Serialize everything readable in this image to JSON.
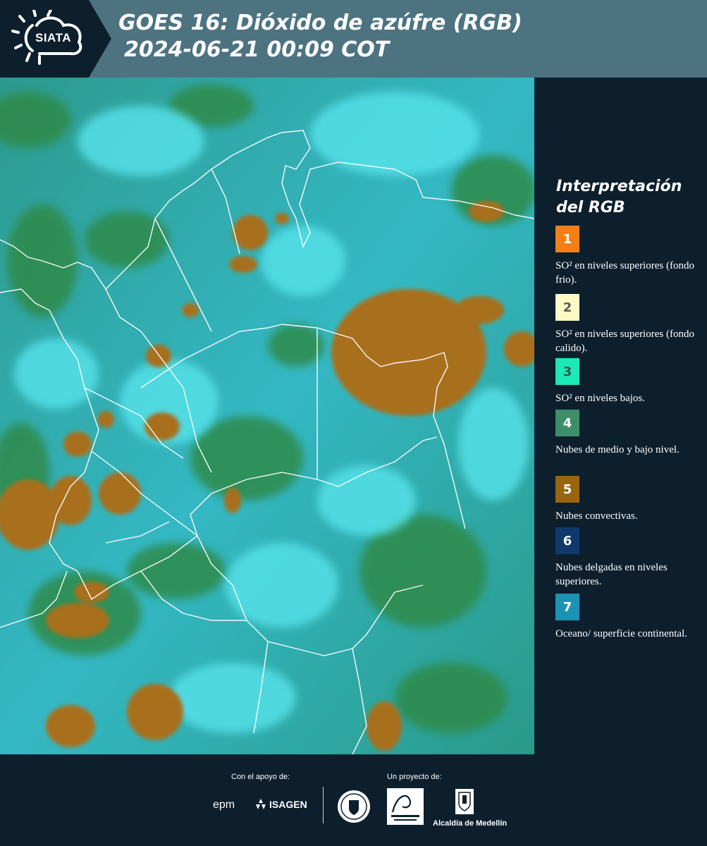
{
  "header": {
    "logo_text": "SIATA",
    "title_line1": "GOES 16: Dióxido de azúfre (RGB)",
    "title_line2": "2024-06-21 00:09 COT"
  },
  "legend": {
    "title": "Interpretación del RGB",
    "items": [
      {
        "number": "1",
        "color": "#f57f17",
        "text_color": "#ffffff",
        "description": "SO² en niveles superiores (fondo frio)."
      },
      {
        "number": "2",
        "color": "#fff9c4",
        "text_color": "#5a5a5a",
        "description": "SO² en niveles superiores (fondo calido)."
      },
      {
        "number": "3",
        "color": "#1de9b6",
        "text_color": "#2a5a55",
        "description": "SO² en niveles bajos."
      },
      {
        "number": "4",
        "color": "#3e8e6a",
        "text_color": "#ffffff",
        "description": "Nubes de medio y bajo nivel."
      },
      {
        "number": "5",
        "color": "#9a6410",
        "text_color": "#ffffff",
        "description": "Nubes convectivas."
      },
      {
        "number": "6",
        "color": "#0f3a6b",
        "text_color": "#ffffff",
        "description": "Nubes delgadas en niveles superiores."
      },
      {
        "number": "7",
        "color": "#1c93b4",
        "text_color": "#ffffff",
        "description": "Oceano/ superficie continental."
      }
    ]
  },
  "footer": {
    "support_label": "Con el apoyo de:",
    "project_label": "Un proyecto de:",
    "sponsor_epm": "epm",
    "sponsor_isagen": "ISAGEN",
    "partner_alcaldia": "Alcaldía de Medellín"
  },
  "colors": {
    "background": "#0d1f2d",
    "header_bar": "#4d7381",
    "cloud_cyan": "#3fd2dc",
    "cloud_brown": "#a8701f",
    "green": "#2f8a4a"
  }
}
